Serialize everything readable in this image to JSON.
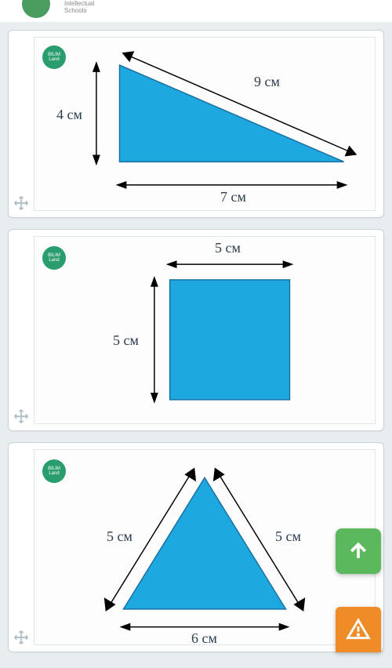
{
  "header": {
    "brand_line1": "Intellectual",
    "brand_line2": "Schools"
  },
  "badge_text": "BILIM Land",
  "cards": [
    {
      "shape": "right-triangle",
      "labels": {
        "left": "4 см",
        "hyp": "9 см",
        "base": "7 см"
      }
    },
    {
      "shape": "square",
      "labels": {
        "top": "5 см",
        "left": "5 см"
      }
    },
    {
      "shape": "isoceles-triangle",
      "labels": {
        "left": "5 см",
        "right": "5 см",
        "base": "6 см"
      }
    }
  ]
}
